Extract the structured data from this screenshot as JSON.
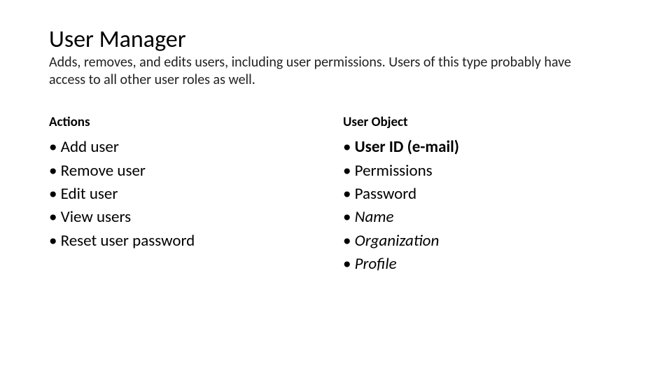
{
  "title": "User Manager",
  "subtitle": "Adds, removes, and edits users, including user permissions. Users of this type probably have access to all other user roles as well.",
  "columns": {
    "actions": {
      "heading": "Actions",
      "items": [
        {
          "label": "Add user",
          "style": "normal"
        },
        {
          "label": "Remove user",
          "style": "normal"
        },
        {
          "label": "Edit user",
          "style": "normal"
        },
        {
          "label": "View users",
          "style": "normal"
        },
        {
          "label": "Reset user password",
          "style": "normal"
        }
      ]
    },
    "user_object": {
      "heading": "User Object",
      "items": [
        {
          "label": "User ID (e-mail)",
          "style": "bold"
        },
        {
          "label": "Permissions",
          "style": "normal"
        },
        {
          "label": "Password",
          "style": "normal"
        },
        {
          "label": "Name",
          "style": "italic"
        },
        {
          "label": "Organization",
          "style": "italic"
        },
        {
          "label": "Profile",
          "style": "italic"
        }
      ]
    }
  }
}
